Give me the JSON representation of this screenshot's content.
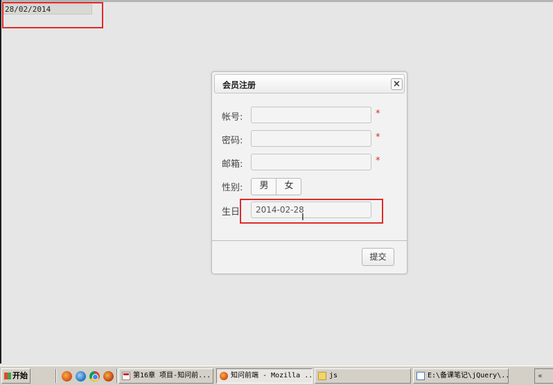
{
  "date_display": {
    "value": "28/02/2014"
  },
  "dialog": {
    "title": "会员注册",
    "close_label": "×",
    "fields": {
      "account_label": "帐号:",
      "password_label": "密码:",
      "email_label": "邮箱:",
      "gender_label": "性别:",
      "birthday_label": "生日",
      "required_mark": "*"
    },
    "inputs": {
      "account": "",
      "password": "",
      "email": "",
      "birthday": "2014-02-28"
    },
    "gender_options": [
      "男",
      "女"
    ],
    "submit_label": "提交"
  },
  "taskbar": {
    "start_label": "开始",
    "tasks": [
      "第16章 项目-知问前...",
      "知问前端 - Mozilla ...",
      "js",
      "E:\\备课笔记\\jQuery\\..."
    ],
    "tray_label": "«"
  },
  "colors": {
    "highlight_box": "#e02a2a",
    "required_mark": "#cc3322",
    "background": "#e6e6e6"
  },
  "icons": [
    "close-icon",
    "i-beam-cursor-icon",
    "firefox-icon",
    "ie-icon",
    "chrome-icon",
    "document-icon",
    "folder-icon",
    "notepad-icon",
    "windows-flag-icon"
  ]
}
